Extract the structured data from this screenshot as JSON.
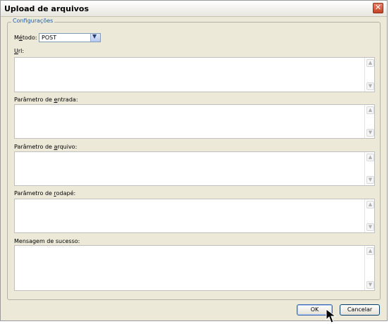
{
  "window": {
    "title": "Upload de arquivos"
  },
  "group": {
    "legend": "Configurações"
  },
  "method": {
    "label_before": "M",
    "label_mnemonic": "é",
    "label_after": "todo:",
    "value": "POST"
  },
  "fields": [
    {
      "label_before": "",
      "label_mnemonic": "U",
      "label_after": "rl:",
      "value": ""
    },
    {
      "label_before": "Parâmetro de ",
      "label_mnemonic": "e",
      "label_after": "ntrada:",
      "value": ""
    },
    {
      "label_before": "Parâmetro de ",
      "label_mnemonic": "a",
      "label_after": "rquivo:",
      "value": ""
    },
    {
      "label_before": "Parâmetro de ",
      "label_mnemonic": "r",
      "label_after": "odapé:",
      "value": ""
    },
    {
      "label_before": "Mensagem de sucesso:",
      "label_mnemonic": "",
      "label_after": "",
      "value": ""
    }
  ],
  "buttons": {
    "ok": "OK",
    "cancel": "Cancelar"
  },
  "icons": {
    "close": "close-icon",
    "dropdown": "chevron-down-icon",
    "cursor": "mouse-pointer-icon"
  }
}
